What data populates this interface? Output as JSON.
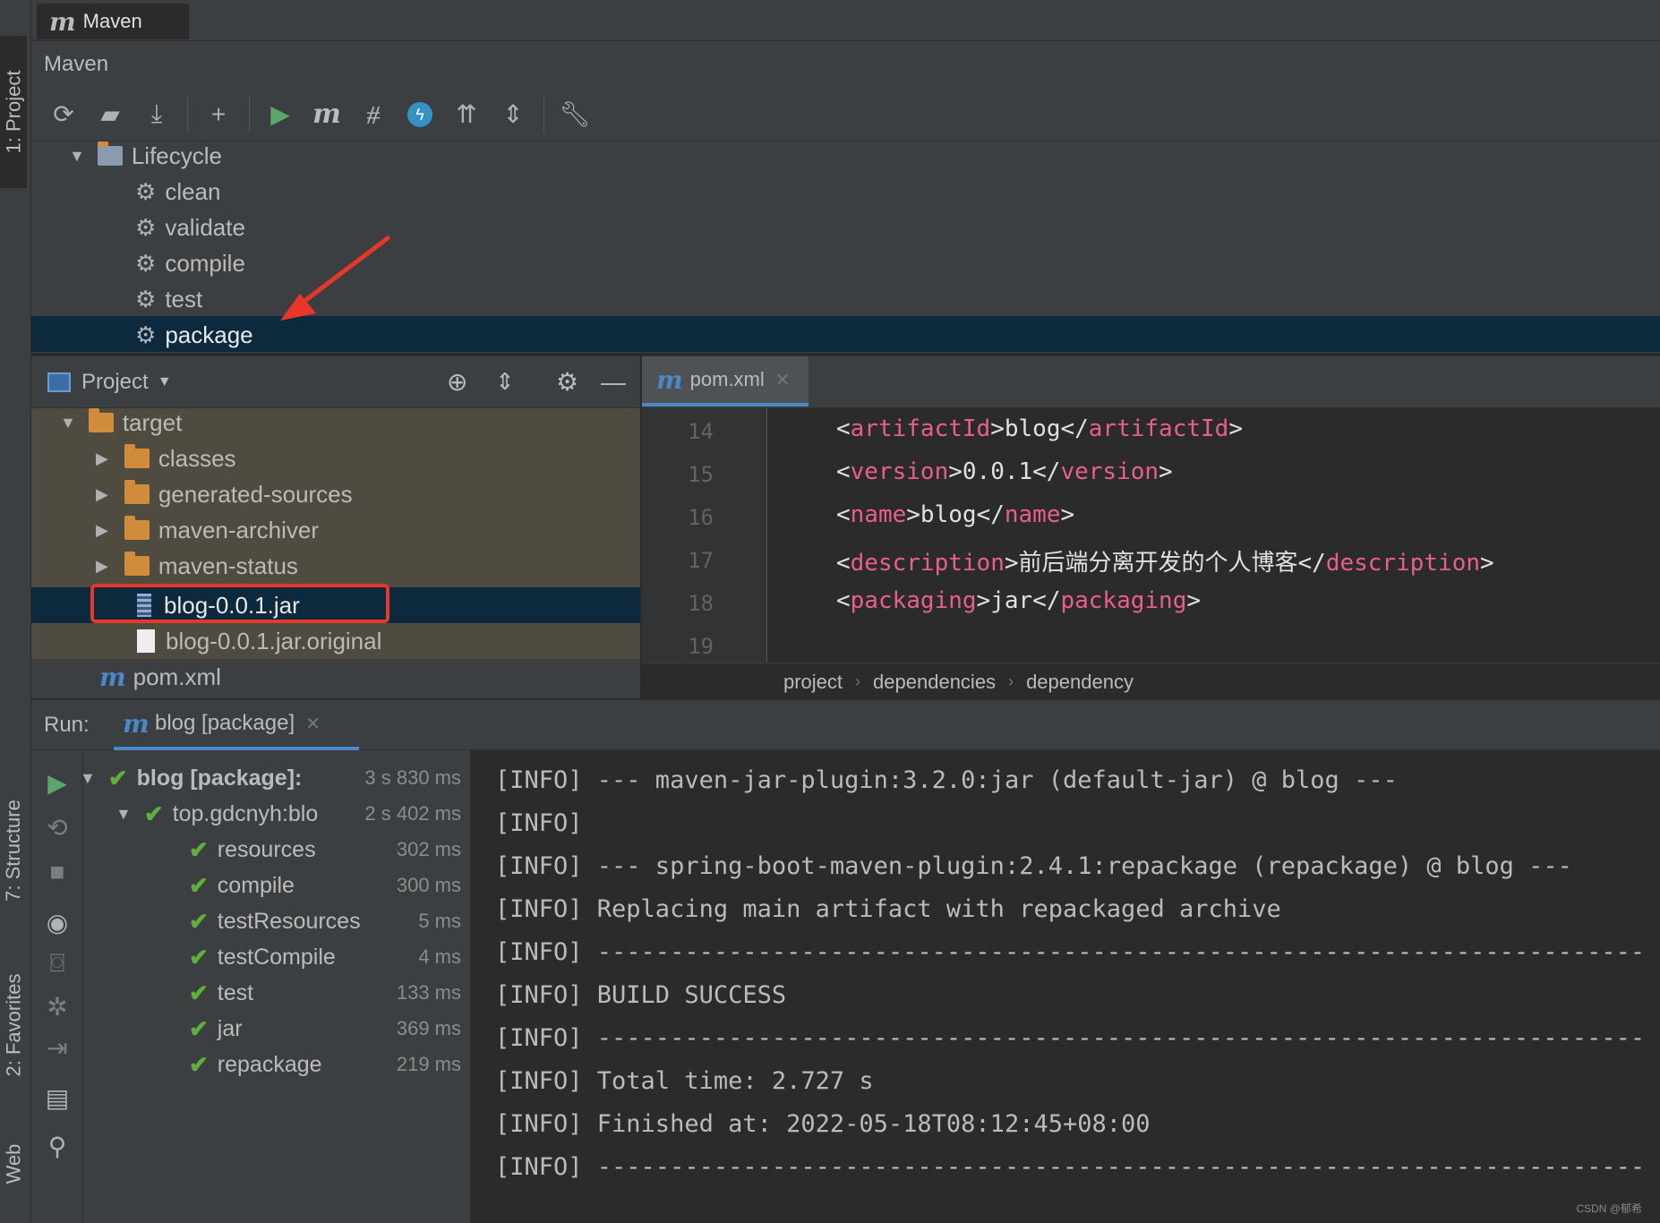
{
  "window": {
    "tab_title": "Maven"
  },
  "left_strip": {
    "project": "1: Project",
    "structure": "7: Structure",
    "favorites": "2: Favorites",
    "web": "Web"
  },
  "maven": {
    "header": "Maven",
    "toolbar_icons": [
      "reload-icon",
      "generate-sources-icon",
      "download-icon",
      "add-icon",
      "run-icon",
      "maven-goal-icon",
      "toggle-offline-icon",
      "skip-tests-icon",
      "show-dependencies-icon",
      "collapse-all-icon",
      "settings-wrench-icon"
    ],
    "lifecycle": {
      "label": "Lifecycle",
      "items": [
        "clean",
        "validate",
        "compile",
        "test",
        "package"
      ],
      "selected": "package"
    }
  },
  "project": {
    "title": "Project",
    "tree": {
      "root": "target",
      "folders": [
        "classes",
        "generated-sources",
        "maven-archiver",
        "maven-status"
      ],
      "jar": "blog-0.0.1.jar",
      "jar_original": "blog-0.0.1.jar.original",
      "pom": "pom.xml"
    }
  },
  "editor": {
    "tab": "pom.xml",
    "lines": [
      {
        "n": "14",
        "open": "<",
        "tag": "artifactId",
        "mid": ">blog</",
        "tag2": "artifactId",
        "end": ">"
      },
      {
        "n": "15",
        "open": "<",
        "tag": "version",
        "mid": ">0.0.1</",
        "tag2": "version",
        "end": ">"
      },
      {
        "n": "16",
        "open": "<",
        "tag": "name",
        "mid": ">blog</",
        "tag2": "name",
        "end": ">"
      },
      {
        "n": "17",
        "open": "<",
        "tag": "description",
        "mid": ">前后端分离开发的个人博客</",
        "tag2": "description",
        "end": ">"
      },
      {
        "n": "18",
        "open": "<",
        "tag": "packaging",
        "mid": ">jar</",
        "tag2": "packaging",
        "end": ">"
      },
      {
        "n": "19",
        "open": "",
        "tag": "",
        "mid": "",
        "tag2": "",
        "end": ""
      }
    ],
    "breadcrumb": [
      "project",
      "dependencies",
      "dependency"
    ]
  },
  "run": {
    "label": "Run:",
    "tab": "blog [package]",
    "tree": [
      {
        "name": "blog [package]:",
        "time": "3 s 830 ms"
      },
      {
        "name": "top.gdcnyh:blo",
        "time": "2 s 402 ms"
      },
      {
        "name": "resources",
        "time": "302 ms"
      },
      {
        "name": "compile",
        "time": "300 ms"
      },
      {
        "name": "testResources",
        "time": "5 ms"
      },
      {
        "name": "testCompile",
        "time": "4 ms"
      },
      {
        "name": "test",
        "time": "133 ms"
      },
      {
        "name": "jar",
        "time": "369 ms"
      },
      {
        "name": "repackage",
        "time": "219 ms"
      }
    ],
    "console": [
      "[INFO] --- maven-jar-plugin:3.2.0:jar (default-jar) @ blog ---",
      "[INFO]",
      "[INFO] --- spring-boot-maven-plugin:2.4.1:repackage (repackage) @ blog ---",
      "[INFO] Replacing main artifact with repackaged archive",
      "[INFO] ------------------------------------------------------------------------",
      "[INFO] BUILD SUCCESS",
      "[INFO] ------------------------------------------------------------------------",
      "[INFO] Total time:  2.727 s",
      "[INFO] Finished at: 2022-05-18T08:12:45+08:00",
      "[INFO] ------------------------------------------------------------------------"
    ]
  },
  "watermark": "CSDN @郁希",
  "colors": {
    "accent": "#4a88c7",
    "selection": "#0d293e",
    "xml_tag": "#e8608a",
    "success": "#5faf3c",
    "annotation": "#e8372a"
  }
}
